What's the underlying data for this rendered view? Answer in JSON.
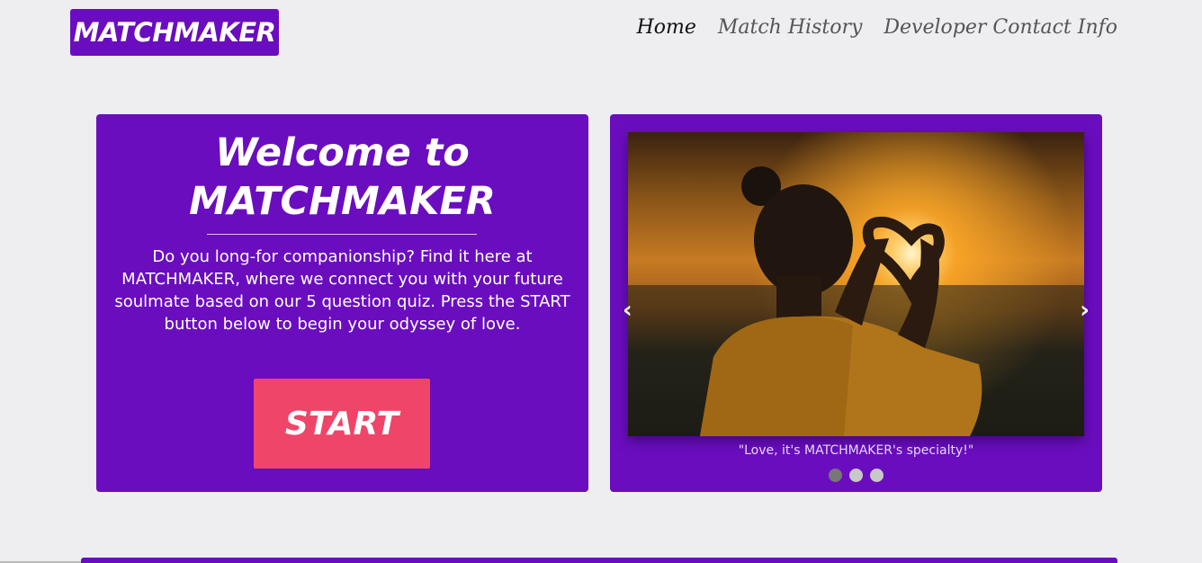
{
  "header": {
    "logo": "MATCHMAKER",
    "nav": [
      {
        "label": "Home",
        "active": true
      },
      {
        "label": "Match History",
        "active": false
      },
      {
        "label": "Developer Contact Info",
        "active": false
      }
    ]
  },
  "welcome": {
    "title_line1": "Welcome to",
    "title_line2": "MATCHMAKER",
    "intro": "Do you long-for companionship? Find it here at MATCHMAKER, where we connect you with your future soulmate based on our 5 question quiz. Press the START button below to begin your odyssey of love.",
    "start_label": "START"
  },
  "carousel": {
    "prev_arrow": "‹",
    "next_arrow": "›",
    "caption": "\"Love, it's MATCHMAKER's specialty!\"",
    "slide_count": 3,
    "active_slide": 1
  },
  "colors": {
    "brand_purple": "#6a0dbf",
    "start_button": "#ef4569",
    "background": "#eeeef1"
  }
}
